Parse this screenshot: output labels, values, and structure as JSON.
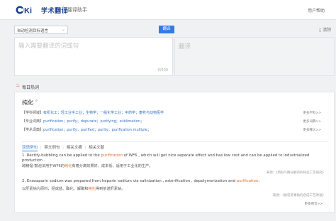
{
  "brand": {
    "logo_mark": "cnki",
    "logo_text": "学术翻译",
    "app_title": "翻译助手",
    "logo_color": "#1a3e8c"
  },
  "topbar": {
    "help_text": "用户帮助"
  },
  "toolbar": {
    "lang_select_value": "自动检测目标语言",
    "translate_label": "翻译",
    "clear_label": "清除",
    "accent_color": "#2f7de1"
  },
  "input": {
    "placeholder": "输入需要翻译的词或句",
    "char_count": "0/500"
  },
  "output": {
    "label": "翻译"
  },
  "hot": {
    "label": "每日热词"
  },
  "term": {
    "title": "纯化",
    "rows": [
      {
        "label": "【学科领域】",
        "tags": "有机化工；轻工业手工业；生物学；一般化学工业；中药学；畜牧与动物医学",
        "more": "更多学科>>"
      },
      {
        "label": "【专业词典】",
        "tags": "purification；purify；depurate；purifying；sublimation；",
        "more": "更多词典>>"
      },
      {
        "label": "【学术词典】",
        "tags": "purification；purify；purified；purity；purification multiple；",
        "more": "更多释义>>"
      }
    ]
  },
  "tabs": [
    {
      "label": "双语例句",
      "active": true
    },
    {
      "label": "英文例句",
      "active": false
    },
    {
      "label": "相关文摘",
      "active": false
    },
    {
      "label": "相关文献",
      "active": false
    }
  ],
  "examples": [
    {
      "en_before": "1. Rectify-bubbling can be applied to the ",
      "en_hl": "purification",
      "en_after": " of WF6 , which will get nice separate effect and has low cost and can be applied to industrialized production .",
      "zh_before": "跨精馏-鼓泡法用于WF6的",
      "zh_hl": "纯化",
      "zh_after": "有着分离效果好，成本低，适用于工业化的生产。",
      "source": "来源：《用低气精分解的的纯化工艺研究》"
    },
    {
      "en_before": "2. Enoxaparin sodium was prepared from heparin sodium via salinization , esterification , depolymerization and ",
      "en_hl": "purification",
      "en_after": ".",
      "zh_before": "以肝素钠为原料，经成盐、酯化、解聚和",
      "zh_hl": "纯化",
      "zh_after": "得到依诺肝素钠。",
      "source": "来源：《依诺肝素钠的合成工艺改进》"
    }
  ],
  "more_examples": "更多例句>>"
}
